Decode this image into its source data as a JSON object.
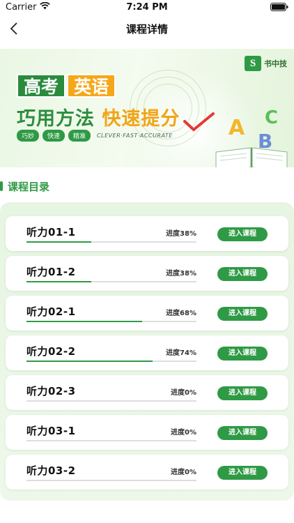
{
  "status_bar": {
    "carrier": "Carrier",
    "time": "7:24 PM"
  },
  "nav": {
    "title": "课程详情"
  },
  "banner": {
    "brand_name": "书中技",
    "title_a": "高考",
    "title_b": "英语",
    "slogan_a": "巧用方法",
    "slogan_b": "快速提分",
    "tags": [
      "巧妙",
      "快速",
      "精准"
    ],
    "tagline_en": "CLEVER·FAST·ACCURATE",
    "letters": [
      "A",
      "B",
      "C"
    ]
  },
  "section": {
    "title": "课程目录"
  },
  "courses": [
    {
      "name": "听力01-1",
      "progress_label": "进度38%",
      "progress": 0.38,
      "button": "进入课程"
    },
    {
      "name": "听力01-2",
      "progress_label": "进度38%",
      "progress": 0.38,
      "button": "进入课程"
    },
    {
      "name": "听力02-1",
      "progress_label": "进度68%",
      "progress": 0.68,
      "button": "进入课程"
    },
    {
      "name": "听力02-2",
      "progress_label": "进度74%",
      "progress": 0.74,
      "button": "进入课程"
    },
    {
      "name": "听力02-3",
      "progress_label": "进度0%",
      "progress": 0,
      "button": "进入课程"
    },
    {
      "name": "听力03-1",
      "progress_label": "进度0%",
      "progress": 0,
      "button": "进入课程"
    },
    {
      "name": "听力03-2",
      "progress_label": "进度0%",
      "progress": 0,
      "button": "进入课程"
    }
  ],
  "colors": {
    "accent": "#2f9a45",
    "accent_orange": "#f6a719",
    "panel_bg": "#e7f5e3"
  }
}
